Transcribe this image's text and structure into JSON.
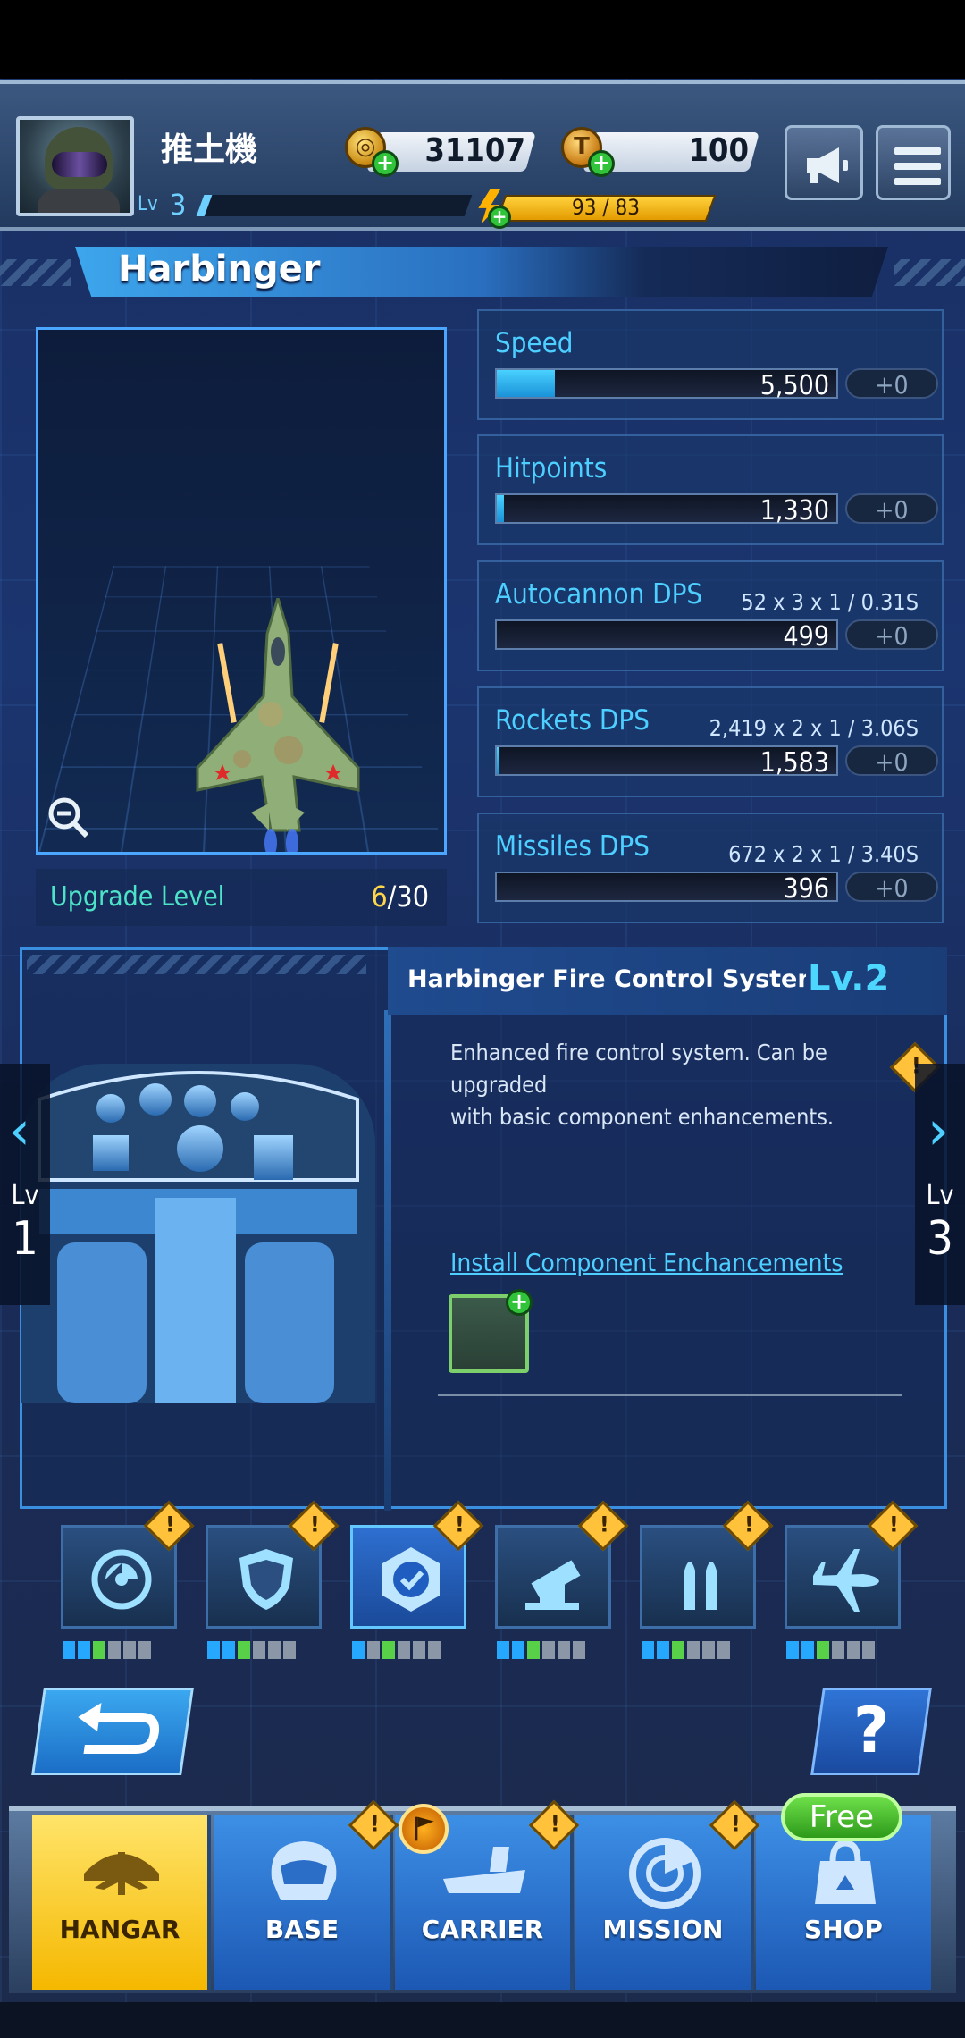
{
  "player": {
    "name": "推土機",
    "level_label": "Lv",
    "level": "3",
    "level_progress": 0.03
  },
  "currency": {
    "coins": "31107",
    "tokens": "100",
    "coin_icon": "coin-icon",
    "token_icon": "token-icon",
    "token_letter": "T"
  },
  "energy": {
    "text": "93 / 83"
  },
  "aircraft": {
    "name": "Harbinger",
    "upgrade_label": "Upgrade Level",
    "upgrade_current": "6",
    "upgrade_max": "/30"
  },
  "stats": [
    {
      "name": "Speed",
      "detail": "",
      "value": "5,500",
      "bonus": "+0",
      "fill": 0.17
    },
    {
      "name": "Hitpoints",
      "detail": "",
      "value": "1,330",
      "bonus": "+0",
      "fill": 0.02
    },
    {
      "name": "Autocannon DPS",
      "detail": "52 x 3 x 1 / 0.31S",
      "value": "499",
      "bonus": "+0",
      "fill": 0
    },
    {
      "name": "Rockets DPS",
      "detail": "2,419 x 2 x 1 / 3.06S",
      "value": "1,583",
      "bonus": "+0",
      "fill": 0.005
    },
    {
      "name": "Missiles DPS",
      "detail": "672 x 2 x 1 / 3.40S",
      "value": "396",
      "bonus": "+0",
      "fill": 0
    }
  ],
  "component": {
    "title": "Harbinger Fire Control System",
    "level": "Lv.2",
    "description_line1": "Enhanced fire control system. Can be upgraded",
    "description_line2": "with basic component enhancements.",
    "install_label": "Install Component Enchancements",
    "prev": {
      "label": "Lv",
      "level": "1"
    },
    "next": {
      "label": "Lv",
      "level": "3"
    }
  },
  "tabs": [
    {
      "icon": "engine-icon",
      "pips": [
        "b",
        "b",
        "g",
        "gy",
        "gy",
        "gy"
      ]
    },
    {
      "icon": "shield-icon",
      "pips": [
        "b",
        "b",
        "g",
        "gy",
        "gy",
        "gy"
      ]
    },
    {
      "icon": "fire-control-icon",
      "pips": [
        "b",
        "gy",
        "g",
        "gy",
        "gy",
        "gy"
      ],
      "active": true
    },
    {
      "icon": "autocannon-icon",
      "pips": [
        "b",
        "b",
        "g",
        "gy",
        "gy",
        "gy"
      ]
    },
    {
      "icon": "rockets-icon",
      "pips": [
        "b",
        "b",
        "g",
        "gy",
        "gy",
        "gy"
      ]
    },
    {
      "icon": "missile-jet-icon",
      "pips": [
        "b",
        "b",
        "g",
        "gy",
        "gy",
        "gy"
      ]
    }
  ],
  "warning_symbol": "!",
  "help_label": "?",
  "nav": [
    {
      "label": "HANGAR",
      "active": true
    },
    {
      "label": "BASE"
    },
    {
      "label": "CARRIER"
    },
    {
      "label": "MISSION"
    },
    {
      "label": "SHOP"
    }
  ],
  "free_badge": "Free",
  "colors": {
    "accent": "#4dcfff",
    "gold": "#ffd54a",
    "warning": "#ffc23a",
    "free_green": "#5fd63c"
  }
}
